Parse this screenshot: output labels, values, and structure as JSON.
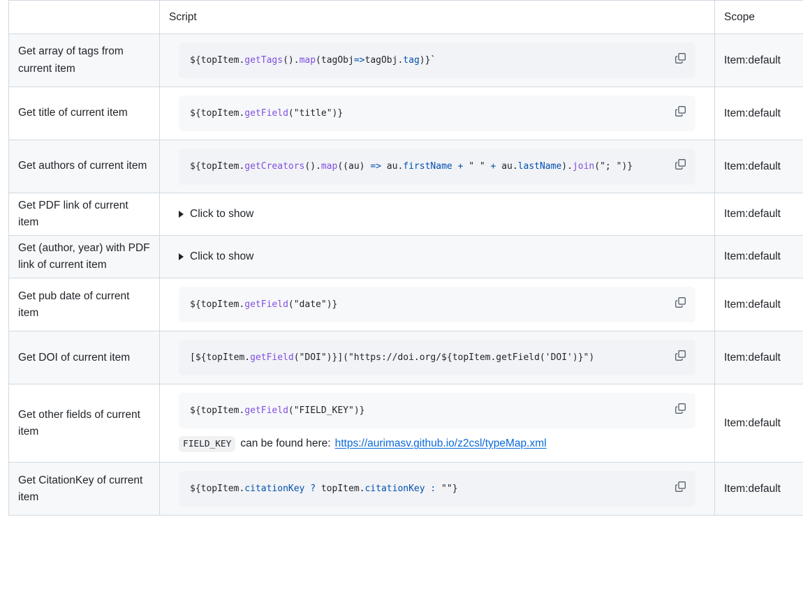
{
  "colors": {
    "page_bg": "#ffffff",
    "border": "#d1d9e0",
    "row_alt_bg": "#f6f8fa",
    "code_bg": "#f6f8fa",
    "text": "#1f2328",
    "link": "#0969da",
    "token_function": "#8250df",
    "token_property": "#0550ae",
    "icon_gray": "#57606a"
  },
  "table": {
    "columns": [
      {
        "key": "name",
        "label": ""
      },
      {
        "key": "script",
        "label": "Script"
      },
      {
        "key": "scope",
        "label": "Scope"
      }
    ],
    "copy_icon": "copy-icon",
    "disclosure_label": "Click to show",
    "rows": [
      {
        "name": "Get array of tags from current item",
        "scope": "Item:default",
        "kind": "code",
        "code_plain": "${topItem.getTags().map(tagObj=>tagObj.tag)}`",
        "tokens": [
          {
            "t": "${topItem.",
            "c": "pln"
          },
          {
            "t": "getTags",
            "c": "fn"
          },
          {
            "t": "().",
            "c": "pln"
          },
          {
            "t": "map",
            "c": "fn"
          },
          {
            "t": "(tagObj",
            "c": "pln"
          },
          {
            "t": "=>",
            "c": "op"
          },
          {
            "t": "tagObj.",
            "c": "pln"
          },
          {
            "t": "tag",
            "c": "prop"
          },
          {
            "t": ")}`",
            "c": "pln"
          }
        ]
      },
      {
        "name": "Get title of current item",
        "scope": "Item:default",
        "kind": "code",
        "code_plain": "${topItem.getField(\"title\")}",
        "tokens": [
          {
            "t": "${topItem.",
            "c": "pln"
          },
          {
            "t": "getField",
            "c": "fn"
          },
          {
            "t": "(\"title\")}",
            "c": "pln"
          }
        ]
      },
      {
        "name": "Get authors of current item",
        "scope": "Item:default",
        "kind": "code",
        "code_plain": "${topItem.getCreators().map((au) => au.firstName + \" \" + au.lastName).join(\"; \")}",
        "tokens": [
          {
            "t": "${topItem.",
            "c": "pln"
          },
          {
            "t": "getCreators",
            "c": "fn"
          },
          {
            "t": "().",
            "c": "pln"
          },
          {
            "t": "map",
            "c": "fn"
          },
          {
            "t": "((au) ",
            "c": "pln"
          },
          {
            "t": "=>",
            "c": "op"
          },
          {
            "t": " au.",
            "c": "pln"
          },
          {
            "t": "firstName",
            "c": "prop"
          },
          {
            "t": " + ",
            "c": "op"
          },
          {
            "t": "\" \"",
            "c": "pln"
          },
          {
            "t": " + ",
            "c": "op"
          },
          {
            "t": "au.",
            "c": "pln"
          },
          {
            "t": "lastName",
            "c": "prop"
          },
          {
            "t": ").",
            "c": "pln"
          },
          {
            "t": "join",
            "c": "fn"
          },
          {
            "t": "(\"; \")}",
            "c": "pln"
          }
        ]
      },
      {
        "name": "Get PDF link of current item",
        "scope": "Item:default",
        "kind": "details"
      },
      {
        "name": "Get (author, year) with PDF link of current item",
        "scope": "Item:default",
        "kind": "details"
      },
      {
        "name": "Get pub date of current item",
        "scope": "Item:default",
        "kind": "code",
        "code_plain": "${topItem.getField(\"date\")}",
        "tokens": [
          {
            "t": "${topItem.",
            "c": "pln"
          },
          {
            "t": "getField",
            "c": "fn"
          },
          {
            "t": "(\"date\")}",
            "c": "pln"
          }
        ]
      },
      {
        "name": "Get DOI of current item",
        "scope": "Item:default",
        "kind": "code",
        "code_plain": "[${topItem.getField(\"DOI\")}](\"https://doi.org/${topItem.getField('DOI')}\")",
        "tokens": [
          {
            "t": "[${topItem.",
            "c": "pln"
          },
          {
            "t": "getField",
            "c": "fn"
          },
          {
            "t": "(\"DOI\")}](\"https://doi.org/${topItem.getField('DOI')}\")",
            "c": "pln"
          }
        ]
      },
      {
        "name": "Get other fields of current item",
        "scope": "Item:default",
        "kind": "code_with_note",
        "code_plain": "${topItem.getField(\"FIELD_KEY\")}",
        "tokens": [
          {
            "t": "${topItem.",
            "c": "pln"
          },
          {
            "t": "getField",
            "c": "fn"
          },
          {
            "t": "(\"FIELD_KEY\")}",
            "c": "pln"
          }
        ],
        "note": {
          "code_pill": "FIELD_KEY",
          "text": "can be found here:",
          "link_text": "https://aurimasv.github.io/z2csl/typeMap.xml"
        }
      },
      {
        "name": "Get CitationKey of current item",
        "scope": "Item:default",
        "kind": "code",
        "code_plain": "${topItem.citationKey ? topItem.citationKey : \"\"}",
        "tokens": [
          {
            "t": "${topItem.",
            "c": "pln"
          },
          {
            "t": "citationKey",
            "c": "prop"
          },
          {
            "t": " ",
            "c": "pln"
          },
          {
            "t": "?",
            "c": "op"
          },
          {
            "t": " topItem.",
            "c": "pln"
          },
          {
            "t": "citationKey",
            "c": "prop"
          },
          {
            "t": " ",
            "c": "pln"
          },
          {
            "t": ":",
            "c": "op"
          },
          {
            "t": " \"\"}",
            "c": "pln"
          }
        ]
      }
    ]
  }
}
